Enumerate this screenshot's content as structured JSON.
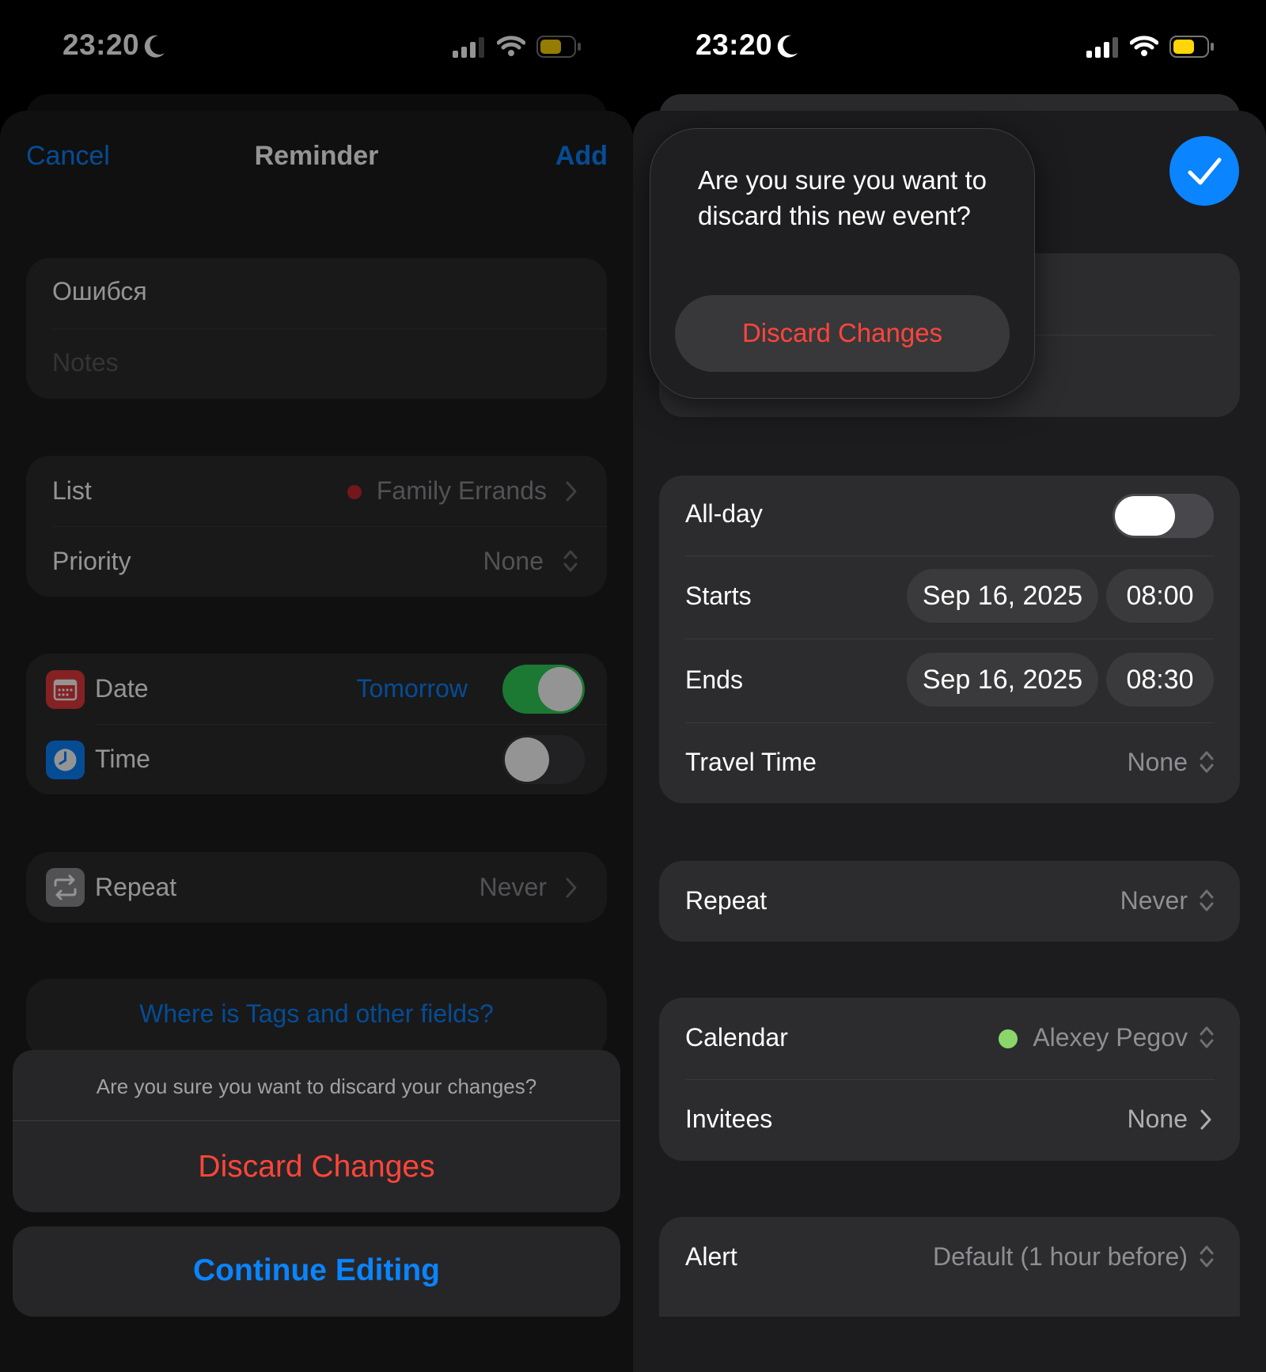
{
  "left": {
    "status": {
      "time": "23:20"
    },
    "nav": {
      "cancel": "Cancel",
      "title": "Reminder",
      "add": "Add"
    },
    "title_field": {
      "value": "Ошибся",
      "notes_placeholder": "Notes"
    },
    "list": {
      "label": "List",
      "value": "Family Errands",
      "dot_color": "#c6282d"
    },
    "priority": {
      "label": "Priority",
      "value": "None"
    },
    "date": {
      "label": "Date",
      "value": "Tomorrow",
      "on": true
    },
    "time": {
      "label": "Time",
      "on": false
    },
    "repeat": {
      "label": "Repeat",
      "value": "Never"
    },
    "tags_link": "Where is Tags and other fields?",
    "action_sheet": {
      "message": "Are you sure you want to discard your changes?",
      "discard": "Discard Changes",
      "continue": "Continue Editing"
    }
  },
  "right": {
    "status": {
      "time": "23:20"
    },
    "popover": {
      "message": "Are you sure you want to discard this new event?",
      "discard": "Discard Changes"
    },
    "allday": {
      "label": "All-day",
      "on": false
    },
    "starts": {
      "label": "Starts",
      "date": "Sep 16, 2025",
      "time": "08:00"
    },
    "ends": {
      "label": "Ends",
      "date": "Sep 16, 2025",
      "time": "08:30"
    },
    "travel": {
      "label": "Travel Time",
      "value": "None"
    },
    "repeat": {
      "label": "Repeat",
      "value": "Never"
    },
    "calendar": {
      "label": "Calendar",
      "value": "Alexey Pegov",
      "dot_color": "#8bd66b"
    },
    "invitees": {
      "label": "Invitees",
      "value": "None"
    },
    "alert": {
      "label": "Alert",
      "value": "Default (1 hour before)"
    }
  },
  "colors": {
    "accent_blue": "#0a84ff",
    "destructive_red": "#ff453a",
    "toggle_green": "#30d158",
    "battery_yellow": "#ffd60a"
  }
}
